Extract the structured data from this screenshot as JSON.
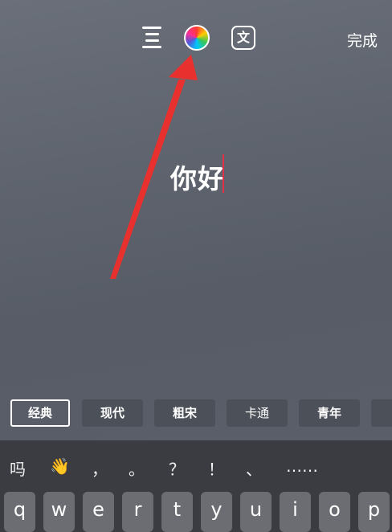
{
  "toolbar": {
    "align_icon": "align-center-icon",
    "color_icon": "color-wheel-icon",
    "translate_icon": "translate-icon",
    "translate_glyph": "文",
    "done_label": "完成"
  },
  "editor": {
    "text": "你好"
  },
  "fonts": [
    {
      "label": "经典",
      "active": true
    },
    {
      "label": "现代",
      "active": false
    },
    {
      "label": "粗宋",
      "active": false
    },
    {
      "label": "卡通",
      "active": false
    },
    {
      "label": "青年",
      "active": false
    }
  ],
  "candidates": [
    "吗",
    "👋",
    "，",
    "。",
    "？",
    "！",
    "、",
    "……"
  ],
  "keys": [
    "q",
    "w",
    "e",
    "r",
    "t",
    "y",
    "u",
    "i",
    "o",
    "p"
  ],
  "colors": {
    "annotation_arrow": "#e8312f",
    "caret": "#e0314a"
  }
}
